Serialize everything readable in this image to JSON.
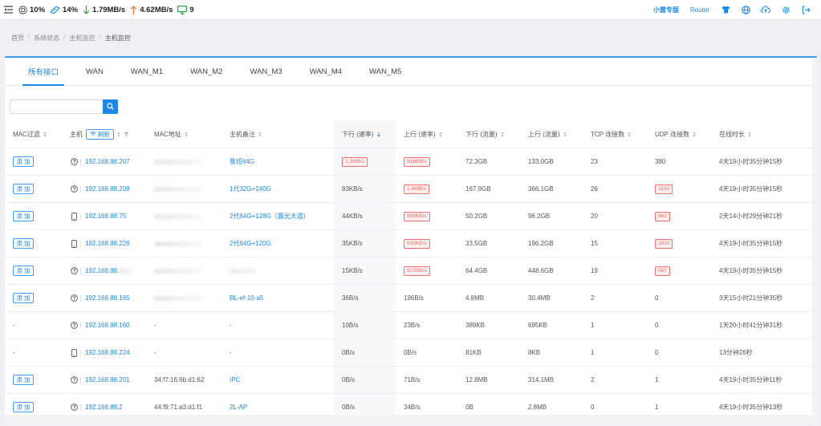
{
  "topbar": {
    "cpu": "10%",
    "mem": "14%",
    "down_speed": "1.79MB/s",
    "up_speed": "4.62MB/s",
    "devices": "9",
    "pro_label": "小雷专版",
    "router_label": "Router"
  },
  "breadcrumb": [
    "首页",
    "系统状态",
    "主机监控",
    "主机监控"
  ],
  "tabs": [
    "所有接口",
    "WAN",
    "WAN_M1",
    "WAN_M2",
    "WAN_M3",
    "WAN_M4",
    "WAN_M5"
  ],
  "search": {
    "value": "",
    "placeholder": ""
  },
  "table": {
    "headers": {
      "mac_filter": "MAC过滤",
      "host": "主机",
      "refresh": "刷新",
      "mac": "MAC地址",
      "note": "主机备注",
      "down_rate": "下行 (速率)",
      "up_rate": "上行 (速率)",
      "down_traffic": "下行 (流量)",
      "up_traffic": "上行 (流量)",
      "tcp": "TCP 连接数",
      "udp": "UDP 连接数",
      "online": "在线时长"
    },
    "add_label": "添 加",
    "rows": [
      {
        "filter": "add",
        "device": "unknown",
        "ip": "192.168.88.207",
        "mac": "",
        "note": "鲁班64G",
        "down": "1.3MB/s",
        "down_hl": true,
        "up": "816KB/s",
        "up_hl": true,
        "dt": "72.3GB",
        "ut": "133.0GB",
        "tcp": "23",
        "udp": "380",
        "udp_hl": false,
        "online": "4天19小时35分钟15秒"
      },
      {
        "filter": "add",
        "device": "unknown",
        "ip": "192.168.88.208",
        "mac": "",
        "note": "1代32G+240G",
        "down": "83KB/s",
        "down_hl": false,
        "up": "1.4MB/s",
        "up_hl": true,
        "dt": "167.9GB",
        "ut": "366.1GB",
        "tcp": "26",
        "udp": "1143",
        "udp_hl": true,
        "online": "4天19小时35分钟15秒"
      },
      {
        "filter": "add",
        "device": "phone",
        "ip": "192.168.88.75",
        "mac": "",
        "note": "2代64G+128G（晨光大道）",
        "down": "44KB/s",
        "down_hl": false,
        "up": "899KB/s",
        "up_hl": true,
        "dt": "50.2GB",
        "ut": "96.2GB",
        "tcp": "20",
        "udp": "862",
        "udp_hl": true,
        "online": "2天14小时29分钟21秒"
      },
      {
        "filter": "add",
        "device": "phone",
        "ip": "192.168.88.226",
        "mac": "",
        "note": "2代64G+120G",
        "down": "35KB/s",
        "down_hl": false,
        "up": "615KB/s",
        "up_hl": true,
        "dt": "33.5GB",
        "ut": "196.2GB",
        "tcp": "15",
        "udp": "1015",
        "udp_hl": true,
        "online": "4天19小时35分钟15秒"
      },
      {
        "filter": "add",
        "device": "unknown",
        "ip": "192.168.88.",
        "mac": "",
        "note": "",
        "down": "15KB/s",
        "down_hl": false,
        "up": "923KB/s",
        "up_hl": true,
        "dt": "64.4GB",
        "ut": "448.6GB",
        "tcp": "19",
        "udp": "567",
        "udp_hl": true,
        "online": "4天19小时35分钟15秒"
      },
      {
        "filter": "add",
        "device": "unknown",
        "ip": "192.168.88.165",
        "mac": "",
        "note": "BL-ef-10-a5",
        "down": "36B/s",
        "down_hl": false,
        "up": "196B/s",
        "up_hl": false,
        "dt": "4.8MB",
        "ut": "30.4MB",
        "tcp": "2",
        "udp": "0",
        "udp_hl": false,
        "online": "3天15小时21分钟35秒"
      },
      {
        "filter": "-",
        "device": "unknown",
        "ip": "192.168.88.160",
        "mac": "-",
        "note": "-",
        "down": "10B/s",
        "down_hl": false,
        "up": "23B/s",
        "up_hl": false,
        "dt": "389KB",
        "ut": "695KB",
        "tcp": "1",
        "udp": "0",
        "udp_hl": false,
        "online": "1天20小时41分钟31秒"
      },
      {
        "filter": "-",
        "device": "phone",
        "ip": "192.168.88.224",
        "mac": "-",
        "note": "-",
        "down": "0B/s",
        "down_hl": false,
        "up": "0B/s",
        "up_hl": false,
        "dt": "81KB",
        "ut": "8KB",
        "tcp": "1",
        "udp": "0",
        "udp_hl": false,
        "online": "13分钟26秒"
      },
      {
        "filter": "add",
        "device": "unknown",
        "ip": "192.168.88.201",
        "mac": "34:f7:16:6b:d1:62",
        "note": "IPC",
        "down": "0B/s",
        "down_hl": false,
        "up": "71B/s",
        "up_hl": false,
        "dt": "12.8MB",
        "ut": "314.1MB",
        "tcp": "2",
        "udp": "1",
        "udp_hl": false,
        "online": "4天19小时35分钟11秒"
      },
      {
        "filter": "add",
        "device": "unknown",
        "ip": "192.168.88.2",
        "mac": "44:f9:71:a3:d1:f1",
        "note": "2L-AP",
        "down": "0B/s",
        "down_hl": false,
        "up": "34B/s",
        "up_hl": false,
        "dt": "0B",
        "ut": "2.8MB",
        "tcp": "0",
        "udp": "1",
        "udp_hl": false,
        "online": "4天19小时35分钟13秒"
      }
    ]
  },
  "colors": {
    "accent": "#1e88e5",
    "danger": "#f56c6c",
    "up_arrow": "#e6762b",
    "down_arrow": "#29a34a",
    "net_icon": "#2c9d3c"
  }
}
